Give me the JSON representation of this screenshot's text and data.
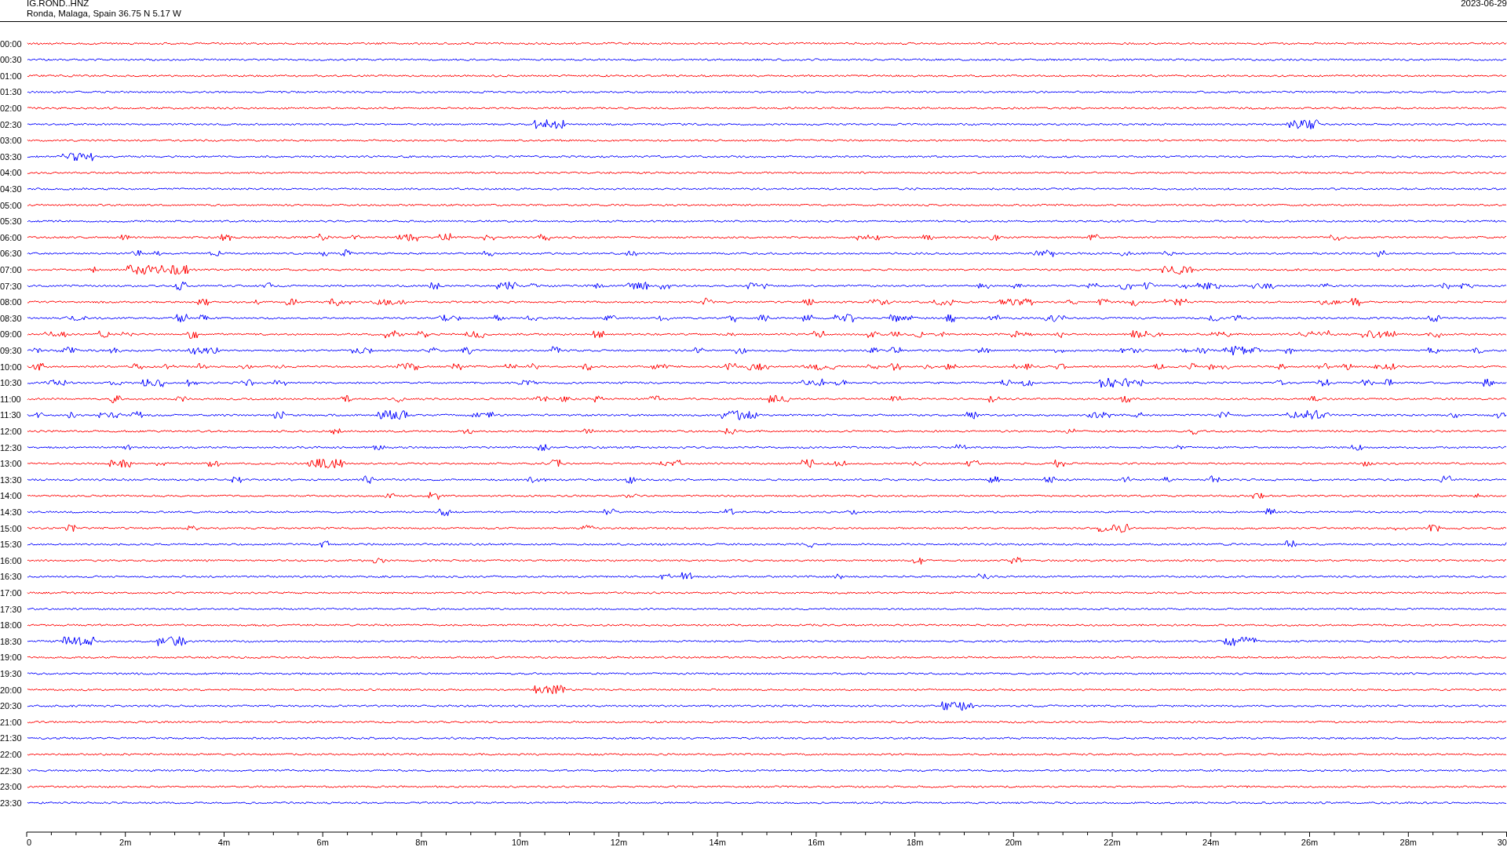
{
  "header": {
    "station": "IG.ROND..HNZ",
    "location": "Ronda, Malaga, Spain  36.75 N 5.17 W",
    "date": "2023-06-29"
  },
  "traces": [
    {
      "label": "00:00",
      "color": "#ff0000"
    },
    {
      "label": "00:30",
      "color": "#0000ff"
    },
    {
      "label": "01:00",
      "color": "#ff0000"
    },
    {
      "label": "01:30",
      "color": "#0000ff"
    },
    {
      "label": "02:00",
      "color": "#ff0000"
    },
    {
      "label": "02:30",
      "color": "#0000ff"
    },
    {
      "label": "03:00",
      "color": "#ff0000"
    },
    {
      "label": "03:30",
      "color": "#0000ff"
    },
    {
      "label": "04:00",
      "color": "#ff0000"
    },
    {
      "label": "04:30",
      "color": "#0000ff"
    },
    {
      "label": "05:00",
      "color": "#ff0000"
    },
    {
      "label": "05:30",
      "color": "#0000ff"
    },
    {
      "label": "06:00",
      "color": "#ff0000"
    },
    {
      "label": "06:30",
      "color": "#0000ff"
    },
    {
      "label": "07:00",
      "color": "#ff0000"
    },
    {
      "label": "07:30",
      "color": "#0000ff"
    },
    {
      "label": "08:00",
      "color": "#ff0000"
    },
    {
      "label": "08:30",
      "color": "#0000ff"
    },
    {
      "label": "09:00",
      "color": "#ff0000"
    },
    {
      "label": "09:30",
      "color": "#0000ff"
    },
    {
      "label": "10:00",
      "color": "#ff0000"
    },
    {
      "label": "10:30",
      "color": "#0000ff"
    },
    {
      "label": "11:00",
      "color": "#ff0000"
    },
    {
      "label": "11:30",
      "color": "#0000ff"
    },
    {
      "label": "12:00",
      "color": "#ff0000"
    },
    {
      "label": "12:30",
      "color": "#0000ff"
    },
    {
      "label": "13:00",
      "color": "#ff0000"
    },
    {
      "label": "13:30",
      "color": "#0000ff"
    },
    {
      "label": "14:00",
      "color": "#ff0000"
    },
    {
      "label": "14:30",
      "color": "#0000ff"
    },
    {
      "label": "15:00",
      "color": "#ff0000"
    },
    {
      "label": "15:30",
      "color": "#0000ff"
    },
    {
      "label": "16:00",
      "color": "#ff0000"
    },
    {
      "label": "16:30",
      "color": "#0000ff"
    },
    {
      "label": "17:00",
      "color": "#ff0000"
    },
    {
      "label": "17:30",
      "color": "#0000ff"
    },
    {
      "label": "18:00",
      "color": "#ff0000"
    },
    {
      "label": "18:30",
      "color": "#0000ff"
    },
    {
      "label": "19:00",
      "color": "#ff0000"
    },
    {
      "label": "19:30",
      "color": "#0000ff"
    },
    {
      "label": "20:00",
      "color": "#ff0000"
    },
    {
      "label": "20:30",
      "color": "#0000ff"
    },
    {
      "label": "21:00",
      "color": "#ff0000"
    },
    {
      "label": "21:30",
      "color": "#0000ff"
    },
    {
      "label": "22:00",
      "color": "#ff0000"
    },
    {
      "label": "22:30",
      "color": "#0000ff"
    },
    {
      "label": "23:00",
      "color": "#ff0000"
    },
    {
      "label": "23:30",
      "color": "#0000ff"
    }
  ],
  "axis_labels": [
    "0",
    "2m",
    "4m",
    "6m",
    "8m",
    "10m",
    "12m",
    "14m",
    "16m",
    "18m",
    "20m",
    "22m",
    "24m",
    "26m",
    "28m",
    "30"
  ]
}
